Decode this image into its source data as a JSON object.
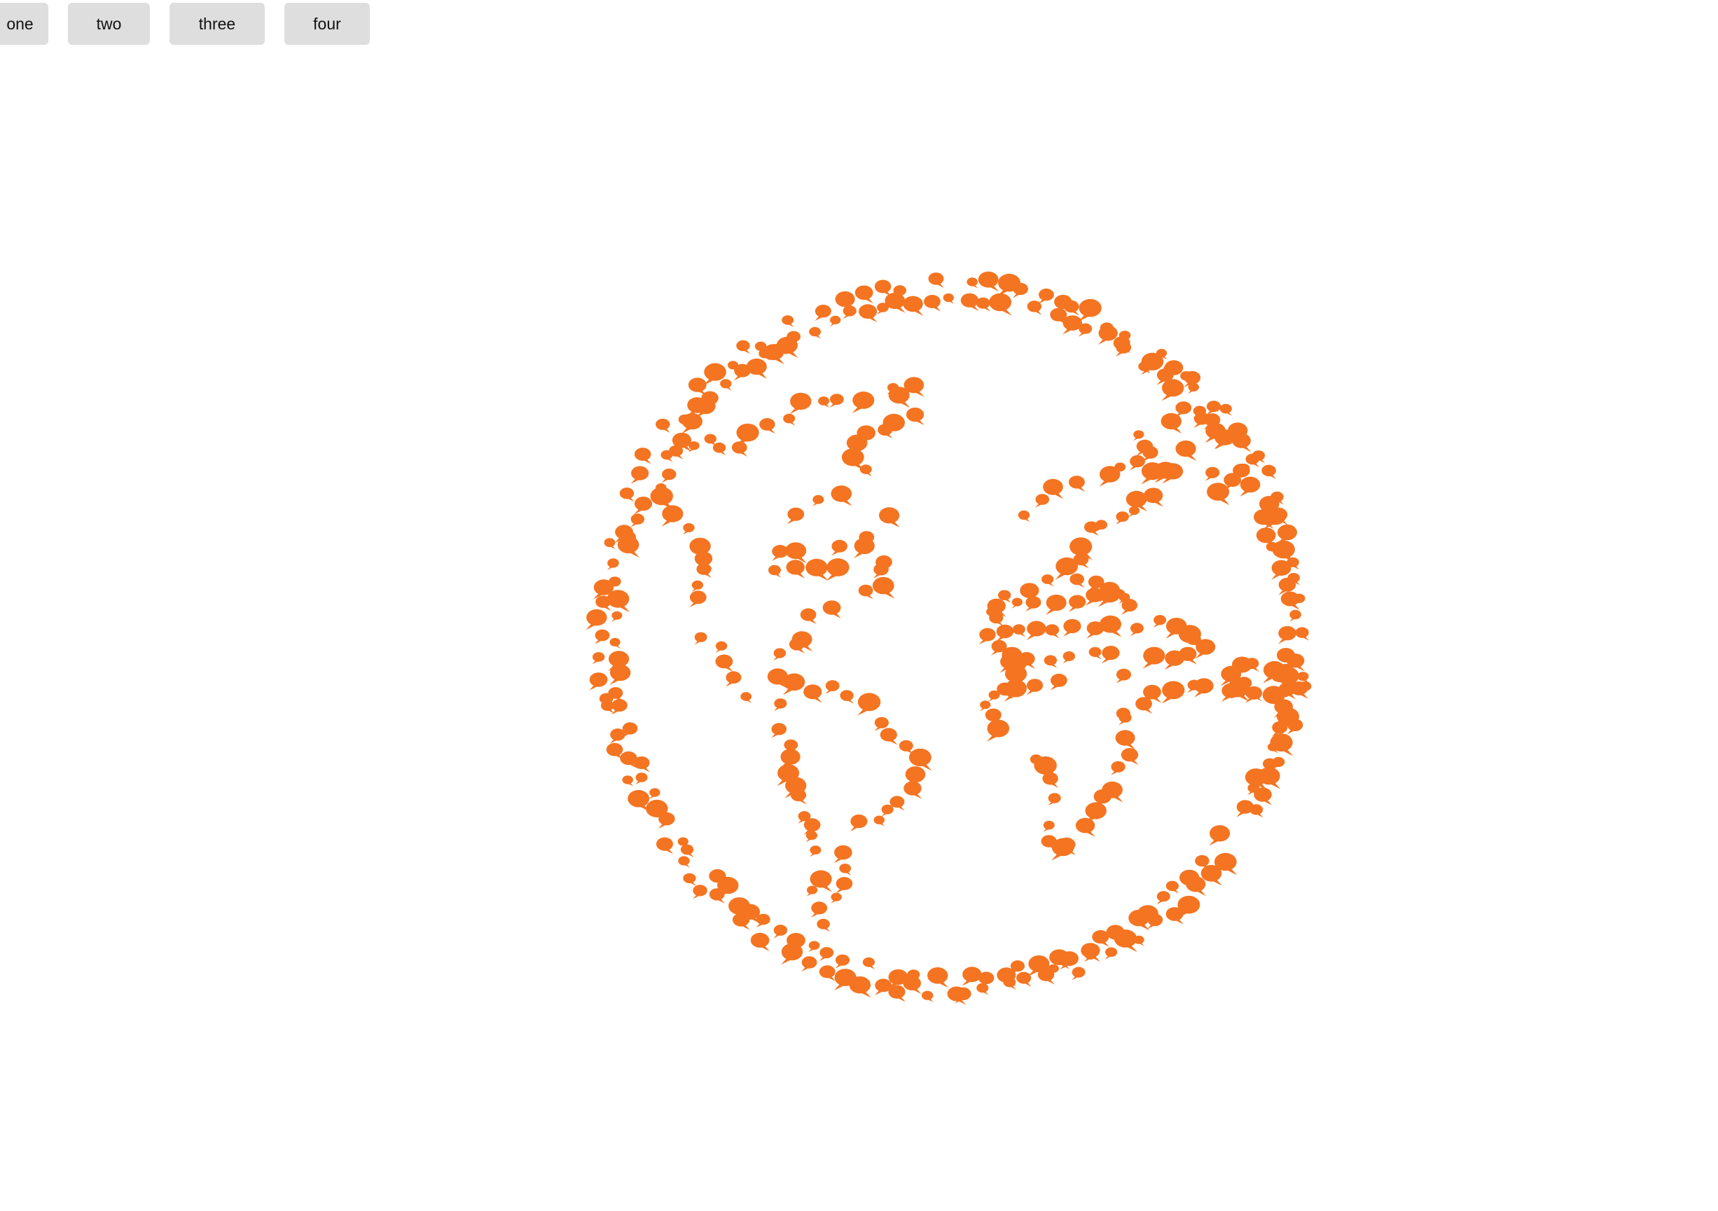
{
  "toolbar": {
    "buttons": [
      {
        "label": "one"
      },
      {
        "label": "two"
      },
      {
        "label": "three"
      },
      {
        "label": "four"
      }
    ]
  },
  "graphic": {
    "icon": "globe-icon",
    "description_kind": "globe outline drawn with speech-bubble dots",
    "dot_color": "#f47421"
  }
}
